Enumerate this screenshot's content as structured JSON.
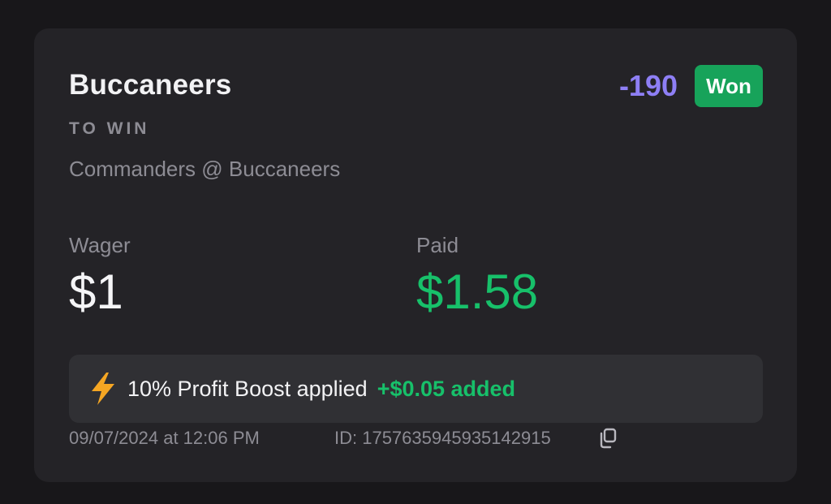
{
  "bet": {
    "selection": "Buccaneers",
    "odds": "-190",
    "status": "Won",
    "market": "TO WIN",
    "matchup": "Commanders @ Buccaneers"
  },
  "wager": {
    "label": "Wager",
    "value": "$1"
  },
  "paid": {
    "label": "Paid",
    "value": "$1.58"
  },
  "boost": {
    "icon": "lightning-bolt-icon",
    "text": "10% Profit Boost applied",
    "added": "+$0.05 added"
  },
  "footer": {
    "timestamp": "09/07/2024 at 12:06 PM",
    "bet_id": "ID: 1757635945935142915",
    "copy_icon": "copy-icon"
  },
  "colors": {
    "background": "#18171a",
    "card": "#242327",
    "odds": "#8e7ff5",
    "won_badge": "#17a35a",
    "paid_green": "#17c06a",
    "bolt": "#f5a623",
    "muted_text": "#8d8c94"
  }
}
